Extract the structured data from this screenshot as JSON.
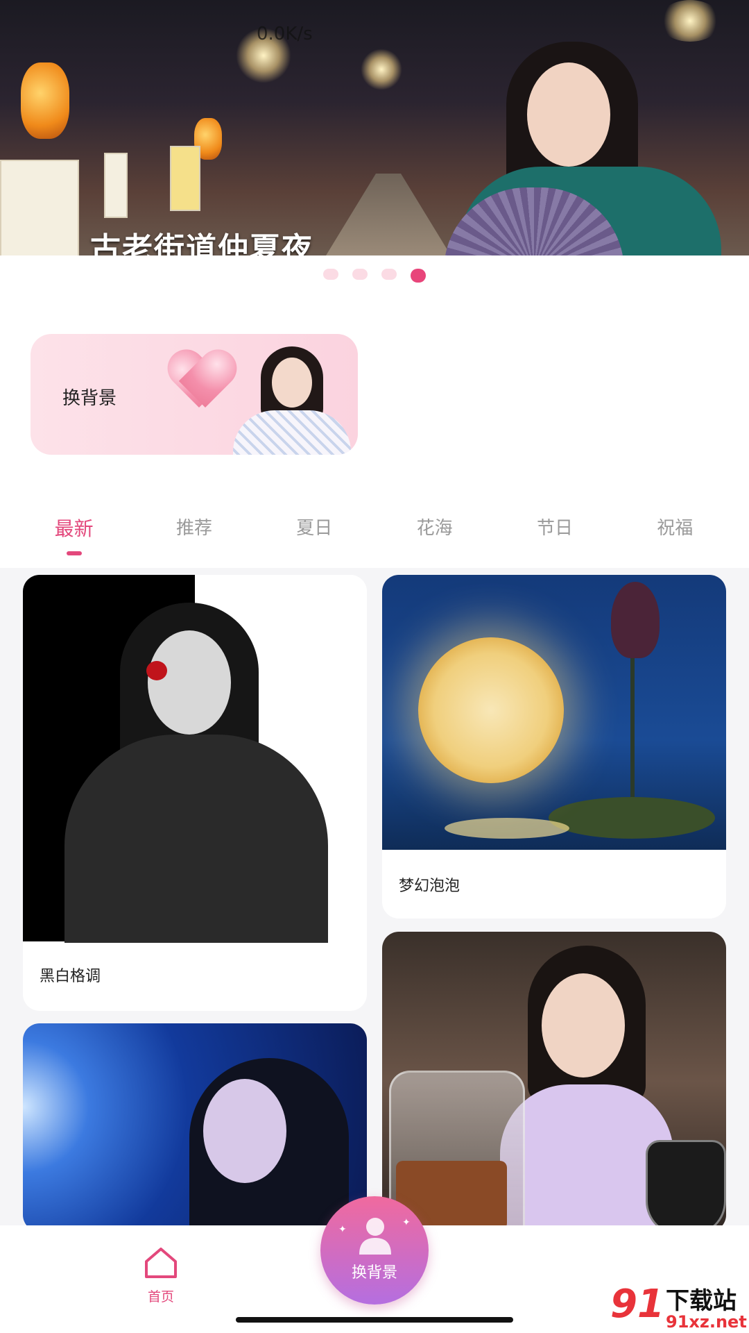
{
  "status_bar": {
    "speed": "0.0K/s"
  },
  "banner": {
    "title": "古老街道仲夏夜",
    "slides": 4,
    "active_slide": 4
  },
  "feature": {
    "label": "换背景"
  },
  "tabs": [
    {
      "label": "最新",
      "active": true
    },
    {
      "label": "推荐",
      "active": false
    },
    {
      "label": "夏日",
      "active": false
    },
    {
      "label": "花海",
      "active": false
    },
    {
      "label": "节日",
      "active": false
    },
    {
      "label": "祝福",
      "active": false
    }
  ],
  "cards": [
    {
      "caption": "黑白格调"
    },
    {
      "caption": "梦幻泡泡"
    },
    {
      "caption": ""
    },
    {
      "caption": ""
    }
  ],
  "bottom_nav": {
    "home_label": "首页",
    "center_label": "换背景",
    "home_icon": "home-icon",
    "center_icon": "person-icon"
  },
  "watermark": {
    "mark": "91",
    "text": "下载站",
    "url": "91xz.net"
  },
  "colors": {
    "accent": "#e3487c",
    "pink_light": "#fbdbe4"
  }
}
